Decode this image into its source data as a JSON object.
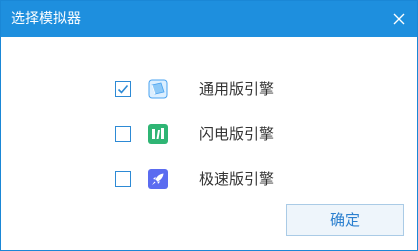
{
  "window": {
    "title": "选择模拟器",
    "close_icon": "close-icon"
  },
  "options": [
    {
      "label": "通用版引擎",
      "checked": true,
      "icon": "general-engine-icon",
      "icon_color": "#4aa3f0"
    },
    {
      "label": "闪电版引擎",
      "checked": false,
      "icon": "lightning-engine-icon",
      "icon_color": "#2fb574"
    },
    {
      "label": "极速版引擎",
      "checked": false,
      "icon": "rocket-engine-icon",
      "icon_color": "#5b6cf0"
    }
  ],
  "confirm_button": {
    "label": "确定"
  },
  "colors": {
    "titlebar": "#1e8fde",
    "accent": "#2d8ad5"
  }
}
